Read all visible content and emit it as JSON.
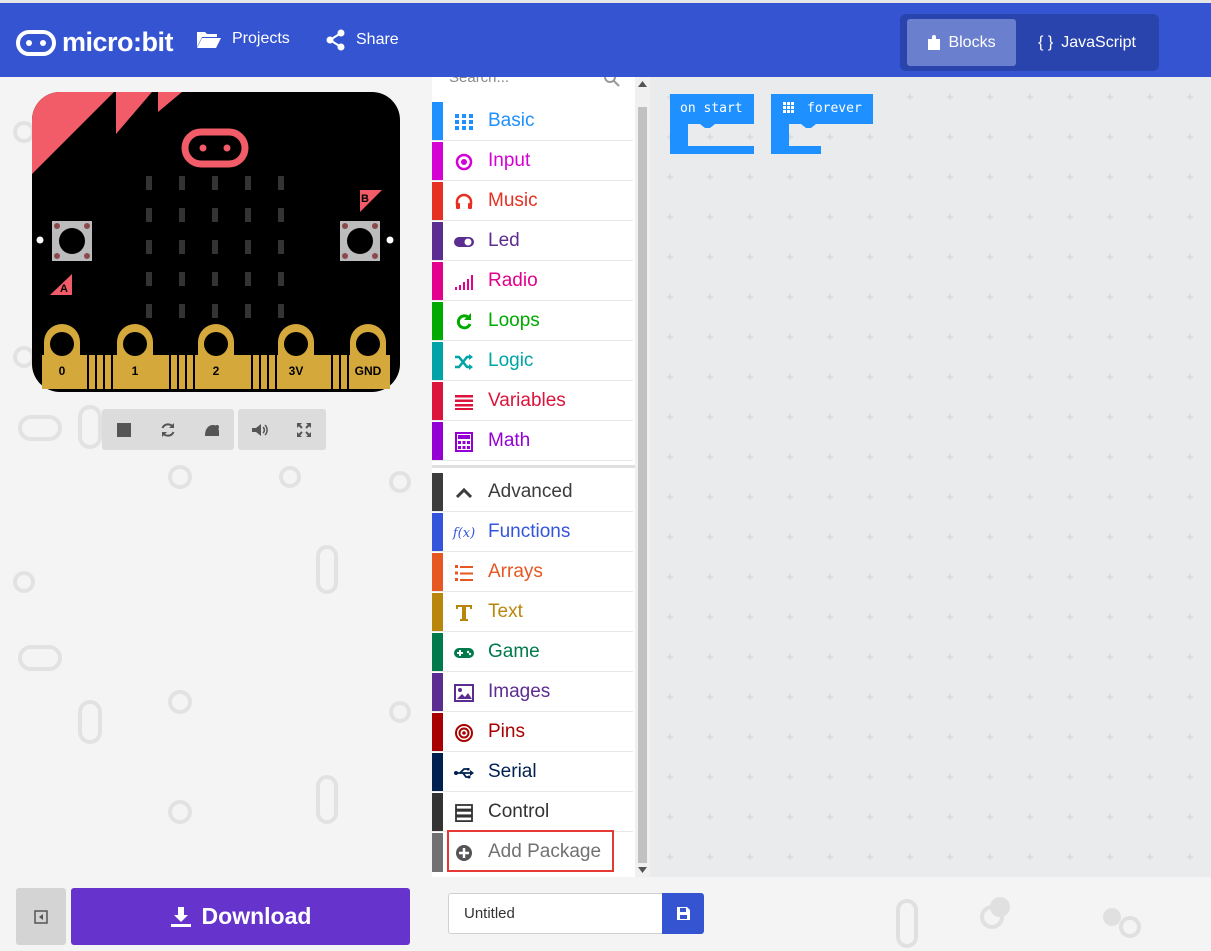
{
  "app": {
    "logo_text": "micro:bit",
    "nav": {
      "projects_label": "Projects",
      "share_label": "Share"
    },
    "editor_toggle": {
      "blocks_label": "Blocks",
      "javascript_label": "JavaScript",
      "active": "Blocks"
    }
  },
  "simulator": {
    "pins": [
      "0",
      "1",
      "2",
      "3V",
      "GND"
    ],
    "button_a": "A",
    "button_b": "B",
    "toolbar_icons": [
      "stop-icon",
      "restart-icon",
      "slow-motion-icon",
      "mute-icon",
      "fullscreen-icon"
    ]
  },
  "toolbox": {
    "search_placeholder": "Search...",
    "categories": [
      {
        "label": "Basic",
        "color": "#1e90ff",
        "icon": "grid-icon"
      },
      {
        "label": "Input",
        "color": "#d400d4",
        "icon": "input-icon"
      },
      {
        "label": "Music",
        "color": "#e63022",
        "icon": "headphones-icon"
      },
      {
        "label": "Led",
        "color": "#5c2d91",
        "icon": "toggle-icon"
      },
      {
        "label": "Radio",
        "color": "#e3008c",
        "icon": "signal-icon"
      },
      {
        "label": "Loops",
        "color": "#00aa00",
        "icon": "loop-icon"
      },
      {
        "label": "Logic",
        "color": "#00a4a6",
        "icon": "shuffle-icon"
      },
      {
        "label": "Variables",
        "color": "#dc143c",
        "icon": "lines-icon"
      },
      {
        "label": "Math",
        "color": "#9400d3",
        "icon": "calculator-icon"
      }
    ],
    "advanced_label": "Advanced",
    "advanced_categories": [
      {
        "label": "Functions",
        "color": "#3455db",
        "icon": "function-icon"
      },
      {
        "label": "Arrays",
        "color": "#e65722",
        "icon": "list-icon"
      },
      {
        "label": "Text",
        "color": "#b8860b",
        "icon": "text-icon"
      },
      {
        "label": "Game",
        "color": "#007a4b",
        "icon": "gamepad-icon"
      },
      {
        "label": "Images",
        "color": "#5c2d91",
        "icon": "image-icon"
      },
      {
        "label": "Pins",
        "color": "#a80000",
        "icon": "target-icon"
      },
      {
        "label": "Serial",
        "color": "#002050",
        "icon": "usb-icon"
      },
      {
        "label": "Control",
        "color": "#333333",
        "icon": "server-icon"
      },
      {
        "label": "Add Package",
        "color": "#717171",
        "icon": "plus-circle-icon"
      }
    ]
  },
  "workspace": {
    "blocks": [
      {
        "label": "on start",
        "color": "#1e90ff"
      },
      {
        "label": "forever",
        "color": "#1e90ff"
      }
    ]
  },
  "footer": {
    "download_label": "Download",
    "project_name": "Untitled"
  }
}
